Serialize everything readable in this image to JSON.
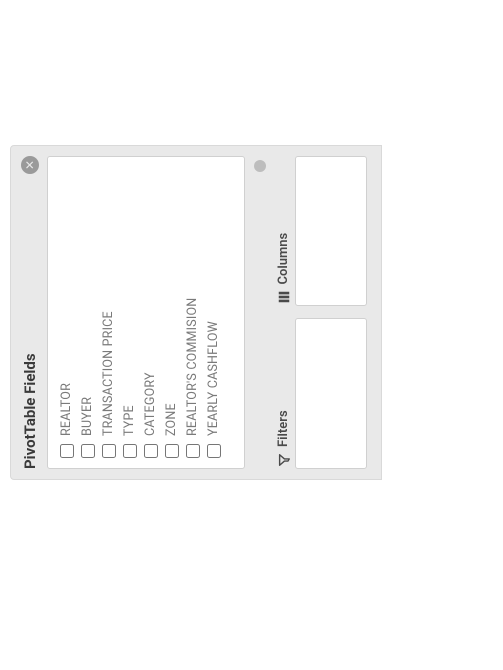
{
  "panel": {
    "title": "PivotTable Fields",
    "close_glyph": "✕"
  },
  "fields": [
    {
      "label": "REALTOR"
    },
    {
      "label": "BUYER"
    },
    {
      "label": "TRANSACTION PRICE"
    },
    {
      "label": "TYPE"
    },
    {
      "label": "CATEGORY"
    },
    {
      "label": "ZONE"
    },
    {
      "label": "REALTOR'S COMMISION"
    },
    {
      "label": "YEARLY CASHFLOW"
    }
  ],
  "areas": {
    "filters": {
      "title": "Filters"
    },
    "columns": {
      "title": "Columns"
    }
  }
}
